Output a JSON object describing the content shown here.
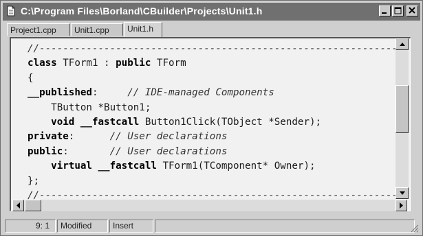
{
  "window": {
    "title": "C:\\Program Files\\Borland\\CBuilder\\Projects\\Unit1.h",
    "title_icon": "document-icon",
    "controls": [
      "minimize-icon",
      "maximize-icon",
      "close-icon"
    ]
  },
  "tabs": [
    {
      "label": "Project1.cpp",
      "active": false
    },
    {
      "label": "Unit1.cpp",
      "active": false
    },
    {
      "label": "Unit1.h",
      "active": true
    }
  ],
  "editor": {
    "lines": [
      [
        {
          "t": "//---------------------------------------------------------------",
          "s": "cm"
        }
      ],
      [
        {
          "t": "class",
          "s": "kw"
        },
        {
          "t": " TForm1 : ",
          "s": ""
        },
        {
          "t": "public",
          "s": "kw"
        },
        {
          "t": " TForm",
          "s": ""
        }
      ],
      [
        {
          "t": "{",
          "s": ""
        }
      ],
      [
        {
          "t": "__published",
          "s": "kw"
        },
        {
          "t": ":     ",
          "s": ""
        },
        {
          "t": "// IDE-managed Components",
          "s": "cm"
        }
      ],
      [
        {
          "t": "    TButton *Button1;",
          "s": ""
        }
      ],
      [
        {
          "t": "    ",
          "s": ""
        },
        {
          "t": "void __fastcall",
          "s": "kw"
        },
        {
          "t": " Button1Click(TObject *Sender);",
          "s": ""
        }
      ],
      [
        {
          "t": "private",
          "s": "kw"
        },
        {
          "t": ":      ",
          "s": ""
        },
        {
          "t": "// User declarations",
          "s": "cm"
        }
      ],
      [
        {
          "t": "public",
          "s": "kw"
        },
        {
          "t": ":       ",
          "s": ""
        },
        {
          "t": "// User declarations",
          "s": "cm"
        }
      ],
      [
        {
          "t": "    ",
          "s": ""
        },
        {
          "t": "virtual __fastcall",
          "s": "kw"
        },
        {
          "t": " TForm1(TComponent* Owner);",
          "s": ""
        }
      ],
      [
        {
          "t": "};",
          "s": ""
        }
      ],
      [
        {
          "t": "//---------------------------------------------------------------",
          "s": "cm"
        }
      ]
    ]
  },
  "statusbar": {
    "position": "9:  1",
    "modified": "Modified",
    "mode": "Insert"
  },
  "colors": {
    "titlebar": "#707070",
    "editor_bg": "#f1f1f1",
    "window_bg": "#cfcfcf"
  }
}
